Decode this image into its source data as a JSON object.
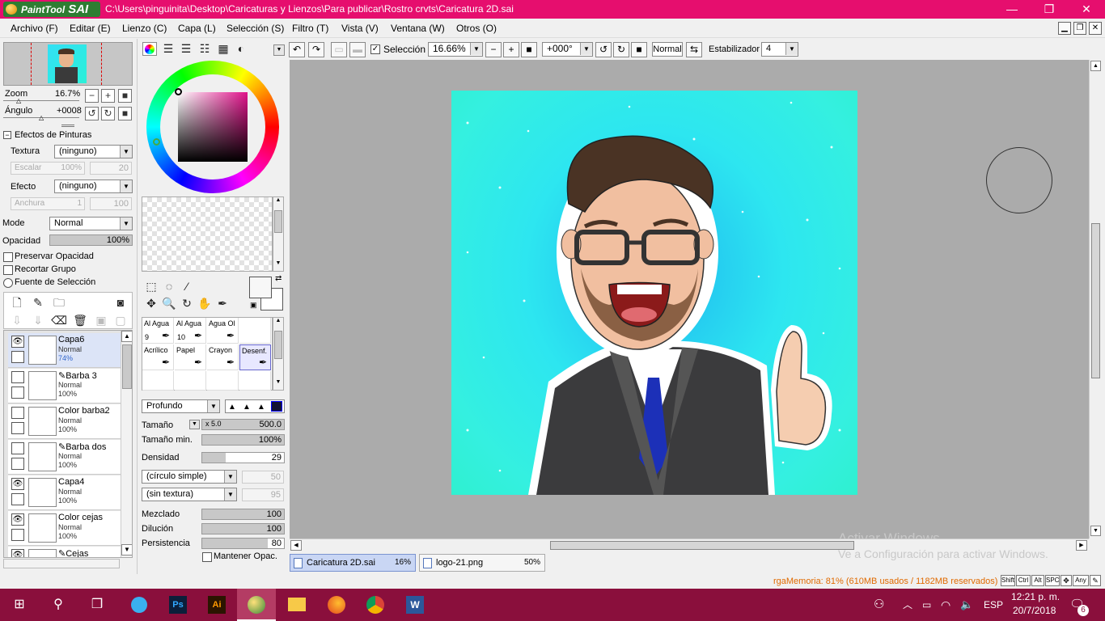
{
  "window": {
    "app_name": "PaintTool",
    "app_name_big": "SAI",
    "path": "C:\\Users\\pinguinita\\Desktop\\Caricaturas y Lienzos\\Para publicar\\Rostro crvts\\Caricatura 2D.sai",
    "min": "—",
    "max": "❐",
    "close": "✕"
  },
  "menu": [
    "Archivo (F)",
    "Editar (E)",
    "Lienzo (C)",
    "Capa (L)",
    "Selección (S)",
    "Filtro (T)",
    "Vista (V)",
    "Ventana (W)",
    "Otros (O)"
  ],
  "navigator": {
    "zoom_label": "Zoom",
    "zoom_value": "16.7%",
    "angle_label": "Ángulo",
    "angle_value": "+0008"
  },
  "effects": {
    "header": "Efectos de Pinturas",
    "texture_label": "Textura",
    "texture_value": "(ninguno)",
    "scale_label": "Escalar",
    "scale_value": "100%",
    "scale_num": "20",
    "effect_label": "Efecto",
    "effect_value": "(ninguno)",
    "width_label": "Anchura",
    "width_value": "1",
    "width_num": "100"
  },
  "layer_props": {
    "mode_label": "Mode",
    "mode_value": "Normal",
    "opacity_label": "Opacidad",
    "opacity_value": "100%",
    "opacity_fraction": 1.0,
    "preserve": "Preservar Opacidad",
    "clip": "Recortar Grupo",
    "source": "Fuente de Selección"
  },
  "layers": [
    {
      "name": "Capa6",
      "mode": "Normal",
      "opacity": "74%",
      "visible": true,
      "selected": true
    },
    {
      "name": "Barba 3",
      "mode": "Normal",
      "opacity": "100%",
      "visible": false,
      "pen": true
    },
    {
      "name": "Color barba2",
      "mode": "Normal",
      "opacity": "100%",
      "visible": false
    },
    {
      "name": "Barba dos",
      "mode": "Normal",
      "opacity": "100%",
      "visible": false,
      "pen": true
    },
    {
      "name": "Capa4",
      "mode": "Normal",
      "opacity": "100%",
      "visible": true
    },
    {
      "name": "Color cejas",
      "mode": "Normal",
      "opacity": "100%",
      "visible": true
    },
    {
      "name": "Cejas",
      "mode": "",
      "opacity": "",
      "visible": true,
      "pen": true
    }
  ],
  "brushes": [
    {
      "label": "Al Agua",
      "num": "9"
    },
    {
      "label": "Al Agua",
      "num": "10"
    },
    {
      "label": "Agua Ol",
      "num": ""
    },
    {
      "label": "",
      "num": ""
    },
    {
      "label": "Acrílico",
      "num": ""
    },
    {
      "label": "Papel",
      "num": ""
    },
    {
      "label": "Crayon",
      "num": ""
    },
    {
      "label": "Desenf.",
      "num": ""
    }
  ],
  "brush_settings": {
    "mode_value": "Profundo",
    "size_label": "Tamaño",
    "size_mult": "x 5.0",
    "size_value": "500.0",
    "min_size_label": "Tamaño min.",
    "min_size_value": "100%",
    "density_label": "Densidad",
    "density_value": "29",
    "shape_value": "(círculo simple)",
    "shape_num": "50",
    "texture_value": "(sin textura)",
    "texture_num": "95",
    "blend_label": "Mezclado",
    "blend_value": "100",
    "dilution_label": "Dilución",
    "dilution_value": "100",
    "persist_label": "Persistencia",
    "persist_value": "80",
    "keep_opac": "Mantener Opac."
  },
  "toolbar": {
    "selection_label": "Selección",
    "zoom_value": "16.66%",
    "angle_value": "+000°",
    "mode_value": "Normal",
    "stabilizer_label": "Estabilizador",
    "stabilizer_value": "4"
  },
  "tabs": [
    {
      "name": "Caricatura 2D.sai",
      "zoom": "16%"
    },
    {
      "name": "logo-21.png",
      "zoom": "50%"
    }
  ],
  "status": {
    "memory": "rgaMemoria: 81% (610MB usados / 1182MB reservados)",
    "keys": [
      "Shift",
      "Ctrl",
      "Alt",
      "SPC",
      "Any"
    ],
    "watermark1": "Activar Windows",
    "watermark2": "Ve a Configuración para activar Windows."
  },
  "taskbar": {
    "lang": "ESP",
    "time": "12:21 p. m.",
    "date": "20/7/2018",
    "notif": "6"
  }
}
